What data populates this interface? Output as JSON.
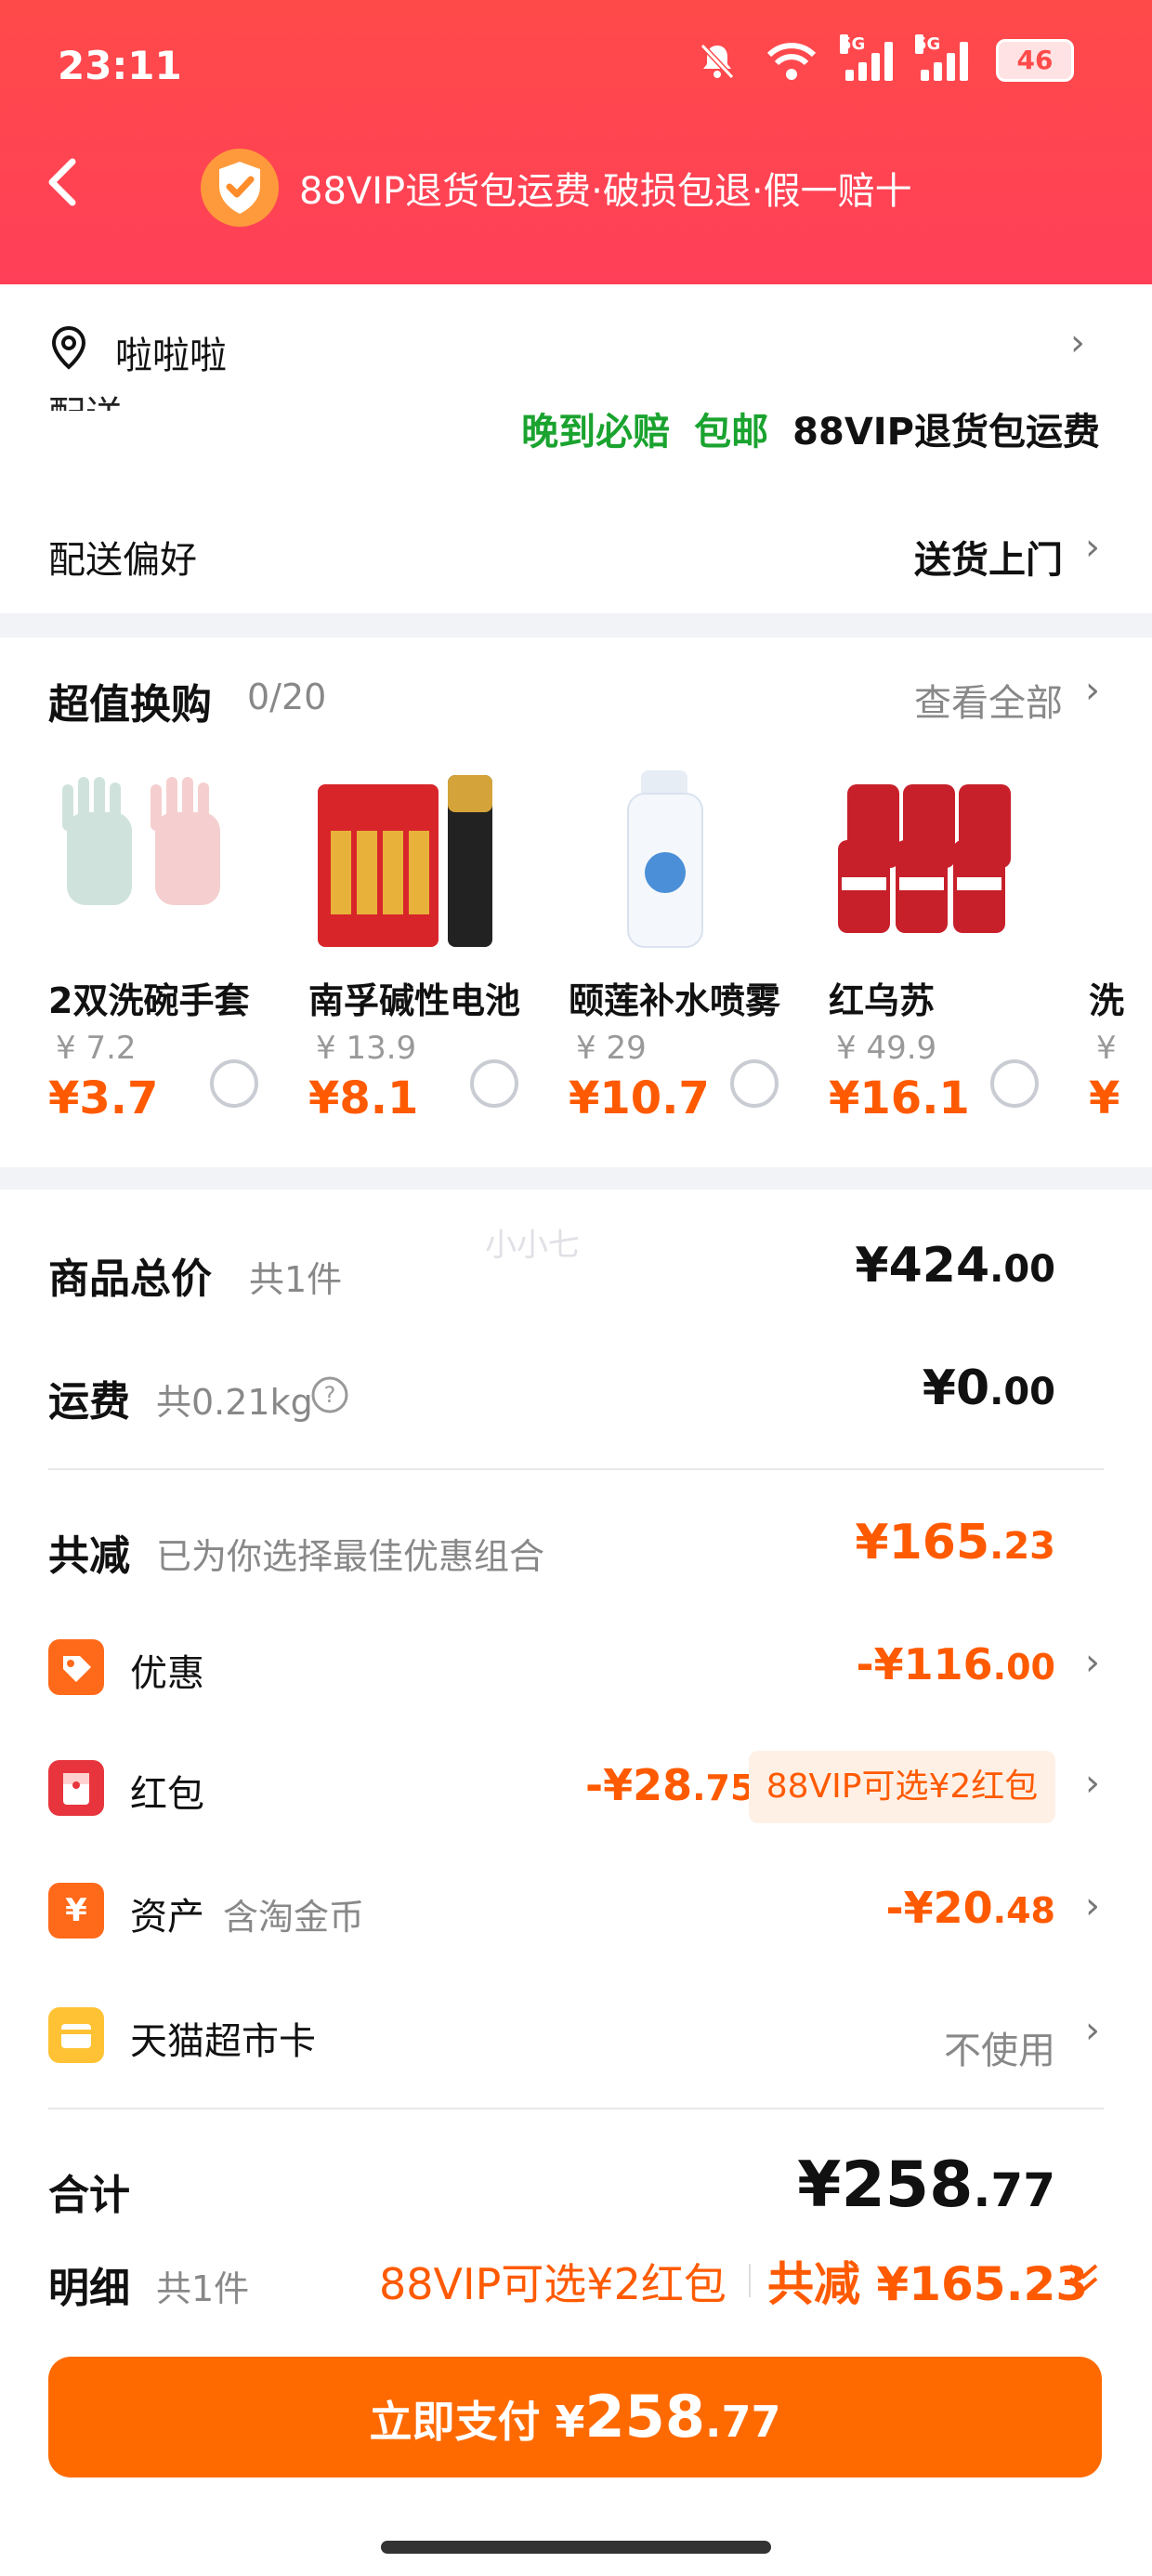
{
  "status": {
    "time": "23:11",
    "battery": "46",
    "sig1": "5G",
    "sig2": "5G"
  },
  "header": {
    "banner": "88VIP退货包运费·破损包退·假一赔十"
  },
  "address": {
    "name": "啦啦啦",
    "cutoff": "配送",
    "tags": [
      "晚到必赔",
      "包邮",
      "88VIP退货包运费"
    ],
    "pref_label": "配送偏好",
    "pref_value": "送货上门"
  },
  "deals": {
    "title": "超值换购",
    "count": "0/20",
    "view_all": "查看全部",
    "items": [
      {
        "name": "2双洗碗手套",
        "orig": "¥ 7.2",
        "price": "¥3.7"
      },
      {
        "name": "南孚碱性电池",
        "orig": "¥ 13.9",
        "price": "¥8.1"
      },
      {
        "name": "颐莲补水喷雾",
        "orig": "¥ 29",
        "price": "¥10.7"
      },
      {
        "name": "红乌苏",
        "orig": "¥ 49.9",
        "price": "¥16.1"
      },
      {
        "name": "洗",
        "orig": "¥",
        "price": "¥"
      }
    ]
  },
  "summary": {
    "watermark": "小小七",
    "total_label": "商品总价",
    "total_sub": "共1件",
    "total_int": "¥424",
    "total_dec": ".00",
    "ship_label": "运费",
    "ship_sub": "共0.21kg",
    "ship_int": "¥0",
    "ship_dec": ".00",
    "reduce_label": "共减",
    "reduce_sub": "已为你选择最佳优惠组合",
    "reduce_int": "¥165",
    "reduce_dec": ".23",
    "discount_label": "优惠",
    "discount_int": "-¥116",
    "discount_dec": ".00",
    "redpacket_label": "红包",
    "redpacket_int": "-¥28",
    "redpacket_dec": ".75",
    "redpacket_pill": "88VIP可选¥2红包",
    "asset_label": "资产",
    "asset_sub": "含淘金币",
    "asset_int": "-¥20",
    "asset_dec": ".48",
    "card_label": "天猫超市卡",
    "card_value": "不使用",
    "sum_label": "合计",
    "sum_int": "¥258",
    "sum_dec": ".77",
    "detail_label": "明细",
    "detail_sub": "共1件",
    "detail_promo": "88VIP可选¥2红包",
    "detail_reduce": "共减 ¥165.23"
  },
  "pay": {
    "label": "立即支付 ¥",
    "int": "258",
    "dec": ".77"
  },
  "colors": {
    "header": "#ff4a4a",
    "accent": "#ff5a00",
    "green": "#1aa32f"
  }
}
